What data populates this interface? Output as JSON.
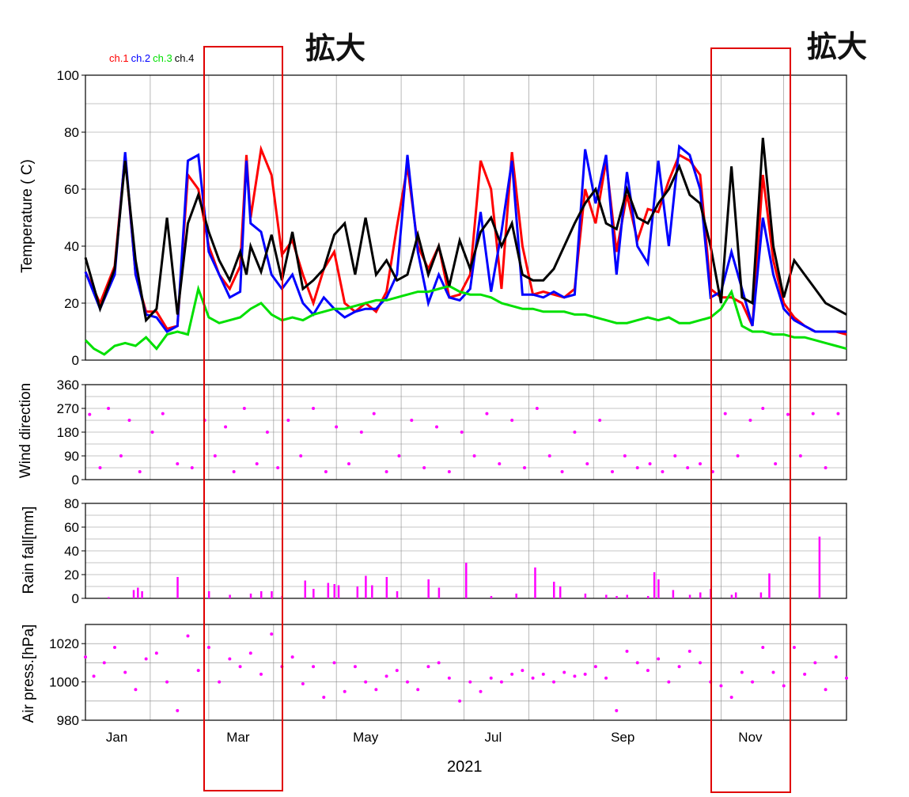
{
  "annotation": {
    "zoom_label": "拡大"
  },
  "legend": [
    {
      "name": "ch.1",
      "color": "#ff0000"
    },
    {
      "name": "ch.2",
      "color": "#0000ff"
    },
    {
      "name": "ch.3",
      "color": "#00e000"
    },
    {
      "name": "ch.4",
      "color": "#000000"
    }
  ],
  "x_axis": {
    "year_label": "2021",
    "month_ticks": [
      "Jan",
      "Mar",
      "May",
      "Jul",
      "Sep",
      "Nov"
    ]
  },
  "colors": {
    "zoom_box": "#e00000",
    "met": "#ff00ff",
    "grid": "#8a8a8a"
  },
  "chart_data": [
    {
      "type": "line",
      "name": "temperature",
      "ylabel": "Temperature ( C)",
      "ylim": [
        0,
        100
      ],
      "yticks": [
        0,
        20,
        40,
        60,
        80,
        100
      ],
      "x_unit": "day of year 2021",
      "xlim": [
        1,
        365
      ],
      "grid": true,
      "series": [
        {
          "name": "ch.1",
          "color": "#ff0000",
          "x": [
            1,
            8,
            15,
            20,
            25,
            30,
            35,
            40,
            45,
            50,
            55,
            60,
            65,
            70,
            75,
            78,
            80,
            85,
            90,
            95,
            100,
            105,
            110,
            115,
            120,
            125,
            130,
            135,
            140,
            145,
            150,
            155,
            160,
            165,
            170,
            175,
            180,
            185,
            190,
            195,
            200,
            205,
            210,
            215,
            220,
            225,
            230,
            235,
            240,
            245,
            250,
            255,
            260,
            265,
            270,
            275,
            280,
            285,
            290,
            295,
            300,
            305,
            310,
            315,
            320,
            325,
            330,
            335,
            340,
            345,
            350,
            355,
            360,
            365
          ],
          "y": [
            31,
            20,
            33,
            72,
            30,
            17,
            17,
            11,
            12,
            65,
            60,
            40,
            30,
            25,
            33,
            72,
            50,
            74,
            65,
            37,
            42,
            30,
            20,
            32,
            38,
            20,
            17,
            20,
            17,
            24,
            47,
            68,
            40,
            32,
            40,
            22,
            23,
            30,
            70,
            60,
            25,
            73,
            40,
            23,
            24,
            23,
            22,
            25,
            60,
            48,
            70,
            38,
            58,
            42,
            53,
            52,
            63,
            72,
            70,
            65,
            25,
            22,
            22,
            20,
            12,
            65,
            35,
            20,
            15,
            12,
            10,
            10,
            10,
            9
          ]
        },
        {
          "name": "ch.2",
          "color": "#0000ff",
          "x": [
            1,
            8,
            15,
            20,
            25,
            30,
            35,
            40,
            45,
            50,
            55,
            60,
            65,
            70,
            75,
            78,
            80,
            85,
            90,
            95,
            100,
            105,
            110,
            115,
            120,
            125,
            130,
            135,
            140,
            145,
            150,
            155,
            160,
            165,
            170,
            175,
            180,
            185,
            190,
            195,
            200,
            205,
            210,
            215,
            220,
            225,
            230,
            235,
            240,
            245,
            250,
            255,
            260,
            265,
            270,
            275,
            280,
            285,
            290,
            295,
            300,
            305,
            310,
            315,
            320,
            325,
            330,
            335,
            340,
            345,
            350,
            355,
            360,
            365
          ],
          "y": [
            31,
            18,
            30,
            73,
            30,
            16,
            15,
            10,
            12,
            70,
            72,
            38,
            30,
            22,
            24,
            70,
            48,
            45,
            30,
            25,
            30,
            20,
            16,
            22,
            18,
            15,
            17,
            18,
            18,
            22,
            30,
            72,
            38,
            20,
            30,
            22,
            21,
            25,
            52,
            24,
            45,
            70,
            23,
            23,
            22,
            24,
            22,
            23,
            74,
            55,
            72,
            30,
            66,
            40,
            34,
            70,
            40,
            75,
            72,
            60,
            22,
            24,
            38,
            25,
            12,
            50,
            30,
            18,
            14,
            12,
            10,
            10,
            10,
            10
          ]
        },
        {
          "name": "ch.3",
          "color": "#00e000",
          "x": [
            1,
            5,
            10,
            15,
            20,
            25,
            30,
            35,
            40,
            45,
            50,
            55,
            60,
            65,
            70,
            75,
            80,
            85,
            90,
            95,
            100,
            105,
            110,
            115,
            120,
            125,
            130,
            135,
            140,
            145,
            150,
            155,
            160,
            165,
            170,
            175,
            180,
            185,
            190,
            195,
            200,
            205,
            210,
            215,
            220,
            225,
            230,
            235,
            240,
            245,
            250,
            255,
            260,
            265,
            270,
            275,
            280,
            285,
            290,
            295,
            300,
            305,
            310,
            315,
            320,
            325,
            330,
            335,
            340,
            345,
            350,
            355,
            360,
            365
          ],
          "y": [
            7,
            4,
            2,
            5,
            6,
            5,
            8,
            4,
            9,
            10,
            9,
            25,
            15,
            13,
            14,
            15,
            18,
            20,
            16,
            14,
            15,
            14,
            16,
            17,
            18,
            18,
            19,
            20,
            21,
            21,
            22,
            23,
            24,
            24,
            25,
            26,
            24,
            23,
            23,
            22,
            20,
            19,
            18,
            18,
            17,
            17,
            17,
            16,
            16,
            15,
            14,
            13,
            13,
            14,
            15,
            14,
            15,
            13,
            13,
            14,
            15,
            18,
            24,
            12,
            10,
            10,
            9,
            9,
            8,
            8,
            7,
            6,
            5,
            4
          ]
        },
        {
          "name": "ch.4",
          "color": "#000000",
          "x": [
            1,
            8,
            15,
            20,
            25,
            30,
            35,
            40,
            45,
            50,
            55,
            60,
            65,
            70,
            75,
            78,
            80,
            85,
            90,
            95,
            100,
            105,
            110,
            115,
            120,
            125,
            130,
            135,
            140,
            145,
            150,
            155,
            160,
            165,
            170,
            175,
            180,
            185,
            190,
            195,
            200,
            205,
            210,
            215,
            220,
            225,
            230,
            235,
            240,
            245,
            250,
            255,
            260,
            265,
            270,
            275,
            280,
            285,
            290,
            295,
            300,
            305,
            310,
            315,
            320,
            325,
            330,
            335,
            340,
            345,
            350,
            355,
            360,
            365
          ],
          "y": [
            36,
            18,
            32,
            70,
            35,
            14,
            18,
            50,
            16,
            48,
            58,
            45,
            35,
            28,
            38,
            30,
            40,
            31,
            44,
            28,
            45,
            25,
            28,
            32,
            44,
            48,
            30,
            50,
            30,
            35,
            28,
            30,
            44,
            30,
            40,
            26,
            42,
            32,
            45,
            50,
            40,
            48,
            30,
            28,
            28,
            32,
            40,
            48,
            55,
            60,
            48,
            46,
            60,
            50,
            48,
            55,
            60,
            68,
            58,
            55,
            40,
            20,
            68,
            22,
            20,
            78,
            40,
            22,
            35,
            30,
            25,
            20,
            18,
            16
          ]
        }
      ]
    },
    {
      "type": "scatter",
      "name": "wind-direction",
      "ylabel": "Wind direction",
      "ylim": [
        0,
        360
      ],
      "yticks": [
        0,
        90,
        180,
        270,
        360
      ],
      "xlim": [
        1,
        365
      ],
      "grid": true,
      "series": [
        {
          "name": "",
          "color": "#ff00ff",
          "x": [
            3,
            8,
            12,
            18,
            22,
            27,
            33,
            38,
            45,
            52,
            58,
            63,
            68,
            72,
            77,
            83,
            88,
            93,
            98,
            104,
            110,
            116,
            121,
            127,
            133,
            139,
            145,
            151,
            157,
            163,
            169,
            175,
            181,
            187,
            193,
            199,
            205,
            211,
            217,
            223,
            229,
            235,
            241,
            247,
            253,
            259,
            265,
            271,
            277,
            283,
            289,
            295,
            301,
            307,
            313,
            319,
            325,
            331,
            337,
            343,
            349,
            355,
            361
          ],
          "y": [
            247,
            45,
            270,
            90,
            225,
            30,
            180,
            250,
            60,
            45,
            225,
            90,
            200,
            30,
            270,
            60,
            180,
            45,
            225,
            90,
            270,
            30,
            200,
            60,
            180,
            250,
            30,
            90,
            225,
            45,
            200,
            30,
            180,
            90,
            250,
            60,
            225,
            45,
            270,
            90,
            30,
            180,
            60,
            225,
            30,
            90,
            45,
            60,
            30,
            90,
            45,
            60,
            30,
            250,
            90,
            225,
            270,
            60,
            247,
            90,
            250,
            45,
            250
          ]
        }
      ]
    },
    {
      "type": "bar",
      "name": "rain-fall",
      "ylabel": "Rain fall[mm]",
      "ylim": [
        0,
        80
      ],
      "yticks": [
        0,
        20,
        40,
        60,
        80
      ],
      "xlim": [
        1,
        365
      ],
      "grid": true,
      "series": [
        {
          "name": "",
          "color": "#ff00ff",
          "x": [
            12,
            24,
            26,
            28,
            45,
            60,
            70,
            80,
            85,
            90,
            95,
            106,
            110,
            117,
            120,
            122,
            131,
            135,
            138,
            145,
            150,
            165,
            170,
            183,
            195,
            207,
            216,
            225,
            228,
            240,
            250,
            255,
            260,
            270,
            273,
            275,
            282,
            290,
            295,
            300,
            310,
            312,
            324,
            328,
            352
          ],
          "y": [
            1,
            7,
            9,
            6,
            18,
            6,
            3,
            4,
            6,
            6,
            2,
            15,
            8,
            13,
            12,
            11,
            10,
            19,
            11,
            18,
            6,
            16,
            9,
            30,
            2,
            4,
            26,
            14,
            10,
            4,
            3,
            2,
            3,
            2,
            22,
            16,
            7,
            3,
            5,
            8,
            3,
            5,
            5,
            21,
            52
          ]
        }
      ]
    },
    {
      "type": "scatter",
      "name": "air-pressure",
      "ylabel": "Air press.[hPa]",
      "ylim": [
        980,
        1030
      ],
      "yticks": [
        980,
        1000,
        1020
      ],
      "xlim": [
        1,
        365
      ],
      "grid": true,
      "series": [
        {
          "name": "",
          "color": "#ff00ff",
          "x": [
            1,
            5,
            10,
            15,
            20,
            25,
            30,
            35,
            40,
            45,
            50,
            55,
            60,
            65,
            70,
            75,
            80,
            85,
            90,
            95,
            100,
            105,
            110,
            115,
            120,
            125,
            130,
            135,
            140,
            145,
            150,
            155,
            160,
            165,
            170,
            175,
            180,
            185,
            190,
            195,
            200,
            205,
            210,
            215,
            220,
            225,
            230,
            235,
            240,
            245,
            250,
            255,
            260,
            265,
            270,
            275,
            280,
            285,
            290,
            295,
            300,
            305,
            310,
            315,
            320,
            325,
            330,
            335,
            340,
            345,
            350,
            355,
            360,
            365
          ],
          "y": [
            1013,
            1003,
            1010,
            1018,
            1005,
            996,
            1012,
            1015,
            1000,
            985,
            1024,
            1006,
            1018,
            1000,
            1012,
            1008,
            1015,
            1004,
            1025,
            1008,
            1013,
            999,
            1008,
            992,
            1010,
            995,
            1008,
            1000,
            996,
            1003,
            1006,
            1000,
            996,
            1008,
            1010,
            1002,
            990,
            1000,
            995,
            1002,
            1000,
            1004,
            1006,
            1002,
            1004,
            1000,
            1005,
            1003,
            1004,
            1008,
            1002,
            985,
            1016,
            1010,
            1006,
            1012,
            1000,
            1008,
            1016,
            1010,
            1000,
            998,
            992,
            1005,
            1000,
            1018,
            1005,
            998,
            1018,
            1004,
            1010,
            996,
            1013,
            1002
          ]
        }
      ]
    }
  ]
}
